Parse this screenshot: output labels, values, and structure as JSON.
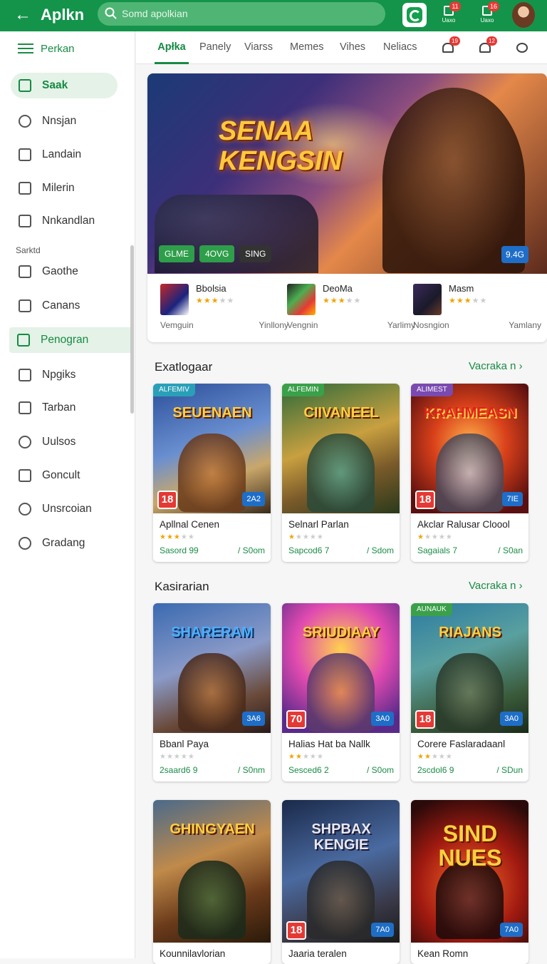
{
  "topbar": {
    "title": "Aplkn",
    "search_placeholder": "Somd apolkian",
    "icon1_badge": "11",
    "icon1_label": "Uaxo",
    "icon2_badge": "16",
    "icon2_label": "Uaxo"
  },
  "sidebar": {
    "header": "Perkan",
    "section": "Sarktd",
    "items": [
      {
        "label": "Saak"
      },
      {
        "label": "Nnsjan"
      },
      {
        "label": "Landain"
      },
      {
        "label": "Milerin"
      },
      {
        "label": "Nnkandlan"
      },
      {
        "label": "Gaothe"
      },
      {
        "label": "Canans"
      },
      {
        "label": "Penogran"
      },
      {
        "label": "Npgiks"
      },
      {
        "label": "Tarban"
      },
      {
        "label": "Uulsos"
      },
      {
        "label": "Goncult"
      },
      {
        "label": "Unsrcoian"
      },
      {
        "label": "Gradang"
      }
    ]
  },
  "tabs": [
    {
      "label": "Apłka"
    },
    {
      "label": "Panely"
    },
    {
      "label": "Viarss"
    },
    {
      "label": "Memes"
    },
    {
      "label": "Vihes"
    },
    {
      "label": "Neliacs"
    }
  ],
  "tab_badges": [
    "19",
    "12"
  ],
  "hero": {
    "title": "SENAA KENGSIN",
    "chips": [
      "GLME",
      "4OVG",
      "SING"
    ],
    "size": "9.4G",
    "mini": [
      {
        "name": "Bbolsia",
        "left": "Vemguin",
        "right": "Yinllony"
      },
      {
        "name": "DeoMa",
        "left": "Vengnin",
        "right": "Yarlimy"
      },
      {
        "name": "Masm",
        "left": "Nosngion",
        "right": "Yamlany"
      }
    ]
  },
  "section1": {
    "title": "Exatlogaar",
    "link": "Vacraka n"
  },
  "section2": {
    "title": "Kasirarian",
    "link": "Vacraka n"
  },
  "cards": [
    {
      "art": "SEUENAEN",
      "tag": "ALFEMIV",
      "age": "18",
      "size": "2A2",
      "name": "Apllnal Cenen",
      "dl": "Sasord 99",
      "sz": "/ S0om"
    },
    {
      "art": "CIIVANEEL",
      "tag": "ALFEMIN",
      "age": "",
      "size": "",
      "name": "Selnarl Parlan",
      "dl": "Sapcod6 7",
      "sz": "/ Sdom"
    },
    {
      "art": "KRAHMEASN",
      "tag": "ALIMEST",
      "age": "18",
      "size": "7IE",
      "name": "Akclar Ralusar Cloool",
      "dl": "Sagaials 7",
      "sz": "/ S0an"
    },
    {
      "art": "SHARERAM",
      "tag": "",
      "age": "",
      "size": "3A6",
      "name": "Bbanl Paya",
      "dl": "2saard6 9",
      "sz": "/ S0nm"
    },
    {
      "art": "SRIUDIAAY",
      "tag": "",
      "age": "70",
      "size": "3A0",
      "name": "Halias Hat ba Nallk",
      "dl": "Sesced6 2",
      "sz": "/ S0om"
    },
    {
      "art": "RIAJANS",
      "tag": "AUNAUK",
      "age": "18",
      "size": "3A0",
      "name": "Corere Faslaradaanl",
      "dl": "2scdol6 9",
      "sz": "/ SDun"
    },
    {
      "art": "GHINGYAEN",
      "tag": "",
      "age": "",
      "size": "",
      "name": "Kounnilavlorian",
      "dl": "",
      "sz": ""
    },
    {
      "art": "SHPBAX KENGIE",
      "tag": "",
      "age": "18",
      "size": "7A0",
      "name": "Jaaria teralen",
      "dl": "",
      "sz": ""
    },
    {
      "art": "SIND NUES",
      "tag": "",
      "age": "",
      "size": "7A0",
      "name": "Kean Romn",
      "dl": "",
      "sz": ""
    }
  ]
}
